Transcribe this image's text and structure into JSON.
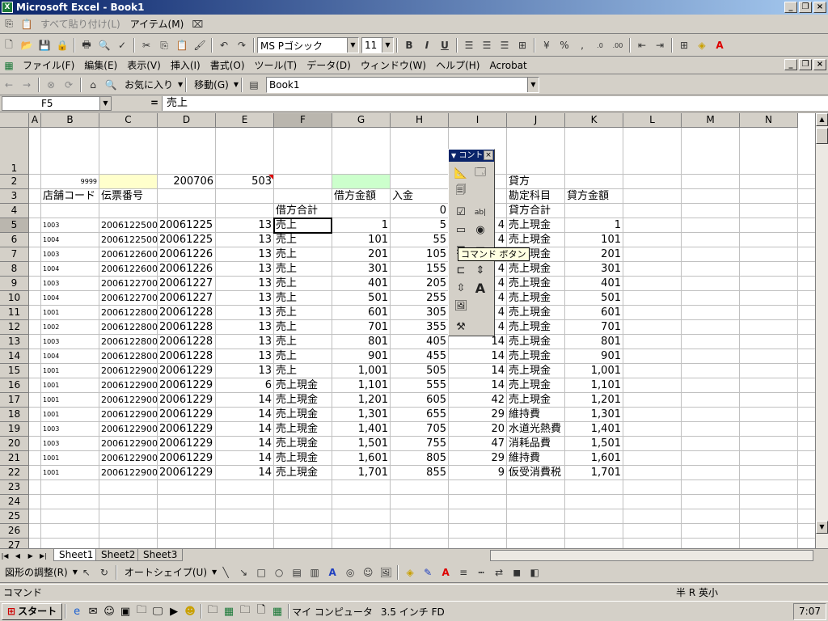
{
  "window": {
    "title": "Microsoft Excel - Book1",
    "icon": "excel-icon"
  },
  "toolbar1": {
    "paste_all": "すべて貼り付け(L)",
    "item": "アイテム(M)"
  },
  "format": {
    "font_name": "MS Pゴシック",
    "font_size": "11"
  },
  "menu": [
    "ファイル(F)",
    "編集(E)",
    "表示(V)",
    "挿入(I)",
    "書式(O)",
    "ツール(T)",
    "データ(D)",
    "ウィンドウ(W)",
    "ヘルプ(H)",
    "Acrobat"
  ],
  "web": {
    "favorites": "お気に入り",
    "goto": "移動(G)",
    "address": "Book1"
  },
  "formula_bar": {
    "name_box": "F5",
    "eq": "=",
    "content": "売上"
  },
  "columns": [
    "A",
    "B",
    "C",
    "D",
    "E",
    "F",
    "G",
    "H",
    "I",
    "J",
    "K",
    "L",
    "M",
    "N"
  ],
  "rows": [
    "1",
    "2",
    "3",
    "4",
    "5",
    "6",
    "7",
    "8",
    "9",
    "10",
    "11",
    "12",
    "13",
    "14",
    "15",
    "16",
    "17",
    "18",
    "19",
    "20",
    "21",
    "22",
    "23",
    "24",
    "25",
    "26",
    "27"
  ],
  "cells": {
    "r2": {
      "B": "9999",
      "D": "200706",
      "E": "503",
      "J": "貸方"
    },
    "r3": {
      "B": "店舗コード",
      "C": "伝票番号",
      "G": "借方金額",
      "H": "入金",
      "J": "勘定科目",
      "K": "貸方金額"
    },
    "r4": {
      "F": "借方合計",
      "H": "0",
      "J": "貸方合計"
    }
  },
  "data_rows": [
    {
      "B": "1003",
      "C": "200612250001",
      "D": "20061225",
      "E": "13",
      "F": "売上",
      "G": "1",
      "H": "5",
      "I": "4",
      "J": "売上現金",
      "K": "1"
    },
    {
      "B": "1004",
      "C": "200612250002",
      "D": "20061225",
      "E": "13",
      "F": "売上",
      "G": "101",
      "H": "55",
      "I": "4",
      "J": "売上現金",
      "K": "101"
    },
    {
      "B": "1003",
      "C": "200612260003",
      "D": "20061226",
      "E": "13",
      "F": "売上",
      "G": "201",
      "H": "105",
      "I": "4",
      "J": "売上現金",
      "K": "201"
    },
    {
      "B": "1004",
      "C": "200612260004",
      "D": "20061226",
      "E": "13",
      "F": "売上",
      "G": "301",
      "H": "155",
      "I": "4",
      "J": "売上現金",
      "K": "301"
    },
    {
      "B": "1003",
      "C": "200612270005",
      "D": "20061227",
      "E": "13",
      "F": "売上",
      "G": "401",
      "H": "205",
      "I": "4",
      "J": "売上現金",
      "K": "401"
    },
    {
      "B": "1004",
      "C": "200612270006",
      "D": "20061227",
      "E": "13",
      "F": "売上",
      "G": "501",
      "H": "255",
      "I": "4",
      "J": "売上現金",
      "K": "501"
    },
    {
      "B": "1001",
      "C": "200612280007",
      "D": "20061228",
      "E": "13",
      "F": "売上",
      "G": "601",
      "H": "305",
      "I": "4",
      "J": "売上現金",
      "K": "601"
    },
    {
      "B": "1002",
      "C": "200612280008",
      "D": "20061228",
      "E": "13",
      "F": "売上",
      "G": "701",
      "H": "355",
      "I": "4",
      "J": "売上現金",
      "K": "701"
    },
    {
      "B": "1003",
      "C": "200612280009",
      "D": "20061228",
      "E": "13",
      "F": "売上",
      "G": "801",
      "H": "405",
      "I": "14",
      "J": "売上現金",
      "K": "801"
    },
    {
      "B": "1004",
      "C": "200612280010",
      "D": "20061228",
      "E": "13",
      "F": "売上",
      "G": "901",
      "H": "455",
      "I": "14",
      "J": "売上現金",
      "K": "901"
    },
    {
      "B": "1001",
      "C": "200612290011",
      "D": "20061229",
      "E": "13",
      "F": "売上",
      "G": "1,001",
      "H": "505",
      "I": "14",
      "J": "売上現金",
      "K": "1,001"
    },
    {
      "B": "1001",
      "C": "200612290012",
      "D": "20061229",
      "E": "6",
      "F": "売上現金",
      "G": "1,101",
      "H": "555",
      "I": "14",
      "J": "売上現金",
      "K": "1,101"
    },
    {
      "B": "1001",
      "C": "200612290013",
      "D": "20061229",
      "E": "14",
      "F": "売上現金",
      "G": "1,201",
      "H": "605",
      "I": "42",
      "J": "売上現金",
      "K": "1,201"
    },
    {
      "B": "1001",
      "C": "200612290014",
      "D": "20061229",
      "E": "14",
      "F": "売上現金",
      "G": "1,301",
      "H": "655",
      "I": "29",
      "J": "維持費",
      "K": "1,301"
    },
    {
      "B": "1003",
      "C": "200612290015",
      "D": "20061229",
      "E": "14",
      "F": "売上現金",
      "G": "1,401",
      "H": "705",
      "I": "20",
      "J": "水道光熱費",
      "K": "1,401"
    },
    {
      "B": "1003",
      "C": "200612290016",
      "D": "20061229",
      "E": "14",
      "F": "売上現金",
      "G": "1,501",
      "H": "755",
      "I": "47",
      "J": "消耗品費",
      "K": "1,501"
    },
    {
      "B": "1001",
      "C": "200612290017",
      "D": "20061229",
      "E": "14",
      "F": "売上現金",
      "G": "1,601",
      "H": "805",
      "I": "29",
      "J": "維持費",
      "K": "1,601"
    },
    {
      "B": "1001",
      "C": "200612290018",
      "D": "20061229",
      "E": "14",
      "F": "売上現金",
      "G": "1,701",
      "H": "855",
      "I": "9",
      "J": "仮受消費税",
      "K": "1,701"
    }
  ],
  "sheets": [
    "Sheet1",
    "Sheet2",
    "Sheet3"
  ],
  "control_toolbox": {
    "title": "コント",
    "tooltip": "コマンド ボタン"
  },
  "drawing": {
    "adjust": "図形の調整(R)",
    "autoshape": "オートシェイプ(U)"
  },
  "status": {
    "mode": "コマンド",
    "ime": "半 R 英小"
  },
  "taskbar": {
    "start": "スタート",
    "my_computer": "マイ コンピュータ",
    "floppy": "3.5 インチ FD",
    "clock": "7:07"
  },
  "colors": {
    "highlight_c2": "#ffffcc",
    "highlight_g2": "#ccffcc",
    "title_bar": "#0a246a"
  }
}
